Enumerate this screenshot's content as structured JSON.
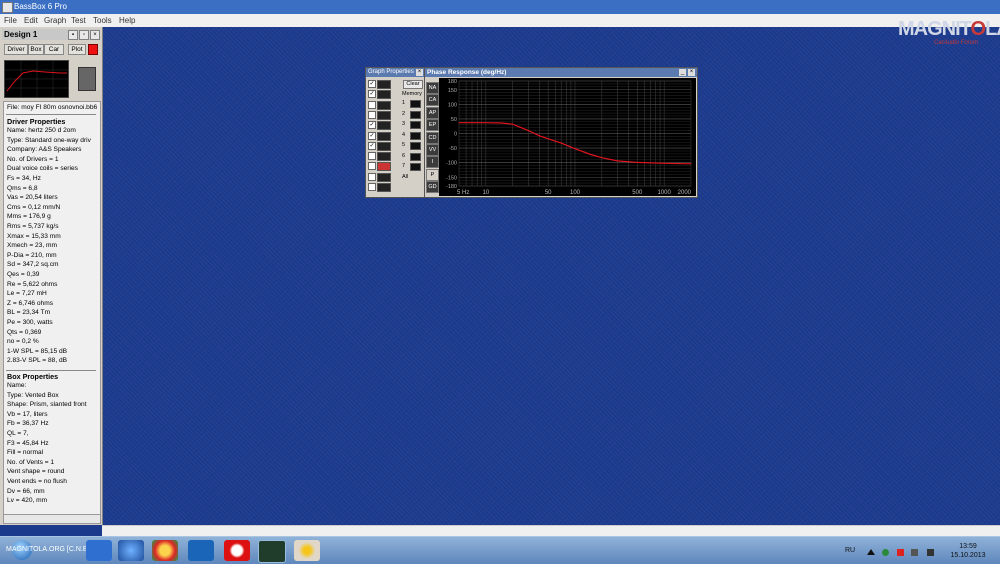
{
  "window": {
    "title": "BassBox 6 Pro"
  },
  "menu": [
    "File",
    "Edit",
    "Graph",
    "Test",
    "Tools",
    "Help"
  ],
  "logo": {
    "text": "MAGNITOLA",
    "sub": "CarAudio Forum"
  },
  "panel": {
    "title": "Design 1",
    "buttons": {
      "driver": "Driver",
      "box": "Box",
      "car": "Car",
      "plot": "Plot"
    },
    "file_line": "File: moy FI 80m osnovnoi.bb6",
    "driver_header": "Driver Properties",
    "driver_lines": [
      "Name: hertz 250 d 2om",
      "Type: Standard one-way driv",
      "Company: A&S Speakers",
      "No. of Drivers = 1",
      "Dual voice coils = series",
      "Fs = 34, Hz",
      "Qms = 6,8",
      "Vas = 20,54 liters",
      "Cms = 0,12 mm/N",
      "Mms = 176,9 g",
      "Rms = 5,737 kg/s",
      "Xmax = 15,33 mm",
      "Xmech = 23, mm",
      "P-Dia = 210, mm",
      "Sd = 347,2 sq.cm",
      "Qes = 0,39",
      "Re = 5,622 ohms",
      "Le = 7,27 mH",
      "Z = 6,746 ohms",
      "BL = 23,34 Tm",
      "Pe = 300, watts",
      "Qts = 0,369",
      "no = 0,2 %",
      "1-W SPL = 85,15 dB",
      "2.83-V SPL = 88, dB"
    ],
    "box_header": "Box Properties",
    "box_lines": [
      "Name:",
      "Type: Vented Box",
      "Shape: Prism, slanted front",
      "Vb = 17, liters",
      "Fb = 36,37 Hz",
      "QL = 7,",
      "F3 = 45,84 Hz",
      "Fill = normal",
      "No. of Vents = 1",
      "  Vent shape = round",
      "  Vent ends = no flush",
      "  Dv = 66, mm",
      "  Lv = 420, mm"
    ]
  },
  "graph_props": {
    "title": "Graph Properties",
    "clear": "Clear",
    "memory": "Memory",
    "numbers": [
      "1",
      "2",
      "3",
      "4",
      "5",
      "6",
      "7",
      "All"
    ]
  },
  "phase": {
    "title": "Phase Response (deg/Hz)",
    "side_buttons": [
      "NA",
      "CA",
      "AP",
      "EP",
      "CD",
      "VV",
      "I",
      "P",
      "GD"
    ]
  },
  "chart_data": {
    "type": "line",
    "title": "Phase Response (deg/Hz)",
    "xlabel": "Hz",
    "ylabel": "",
    "x_scale": "log",
    "xlim": [
      5,
      2000
    ],
    "ylim": [
      -180,
      180
    ],
    "x_ticks": [
      "5 Hz",
      "10",
      "50",
      "100",
      "500",
      "1000",
      "2000"
    ],
    "y_ticks": [
      "180",
      "150",
      "100",
      "50",
      "0",
      "-50",
      "-100",
      "-150",
      "-180"
    ],
    "grid": true,
    "series": [
      {
        "color": "#e0141e",
        "x": [
          5,
          8,
          10,
          15,
          20,
          30,
          40,
          50,
          70,
          100,
          150,
          200,
          300,
          500,
          1000,
          2000
        ],
        "y": [
          37,
          37,
          37,
          36,
          32,
          10,
          -8,
          -18,
          -33,
          -52,
          -72,
          -83,
          -94,
          -99,
          -102,
          -104
        ]
      }
    ]
  },
  "taskbar": {
    "start_text": "MAGNITOLA.ORG [C.N.E.T]",
    "lang": "RU",
    "time": "13:59",
    "date": "15.10.2013"
  }
}
